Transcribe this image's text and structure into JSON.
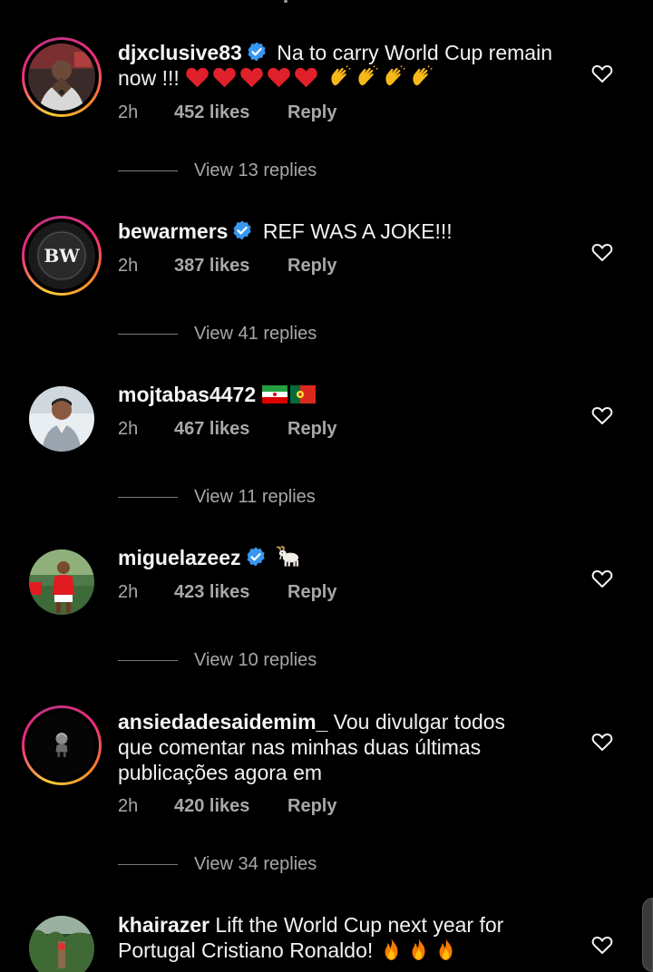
{
  "colors": {
    "background": "#000000",
    "text": "#f5f5f5",
    "muted": "#a8a8a8",
    "verified": "#3897f0"
  },
  "comments": [
    {
      "username": "djxclusive83",
      "verified": true,
      "text_line1": "Na to carry World Cup remain",
      "text_line2": "now !!!",
      "emojis": [
        "red-heart",
        "red-heart",
        "red-heart",
        "red-heart",
        "red-heart",
        "clapping-hands",
        "clapping-hands",
        "clapping-hands",
        "clapping-hands"
      ],
      "time": "2h",
      "likes": "452 likes",
      "reply": "Reply",
      "view_replies": "View 13 replies",
      "has_story_ring": true
    },
    {
      "username": "bewarmers",
      "verified": true,
      "text_line1": "REF WAS A JOKE!!!",
      "avatar_text": "BW",
      "time": "2h",
      "likes": "387 likes",
      "reply": "Reply",
      "view_replies": "View 41 replies",
      "has_story_ring": true
    },
    {
      "username": "mojtabas4472",
      "verified": false,
      "emojis": [
        "iran-flag",
        "portugal-flag"
      ],
      "time": "2h",
      "likes": "467 likes",
      "reply": "Reply",
      "view_replies": "View 11 replies",
      "has_story_ring": false
    },
    {
      "username": "miguelazeez",
      "verified": true,
      "emojis": [
        "goat"
      ],
      "time": "2h",
      "likes": "423 likes",
      "reply": "Reply",
      "view_replies": "View 10 replies",
      "has_story_ring": false
    },
    {
      "username": "ansiedadesaidemim_",
      "verified": false,
      "text_line1": "Vou divulgar todos",
      "text_line2": "que comentar nas minhas duas últimas",
      "text_line3": "publicações agora em",
      "time": "2h",
      "likes": "420 likes",
      "reply": "Reply",
      "view_replies": "View 34 replies",
      "has_story_ring": true
    },
    {
      "username": "khairazer",
      "verified": false,
      "text_line1": "Lift the World Cup next year for",
      "text_line2": "Portugal Cristiano Ronaldo!",
      "emojis": [
        "fire",
        "fire",
        "fire"
      ],
      "has_story_ring": false
    }
  ]
}
